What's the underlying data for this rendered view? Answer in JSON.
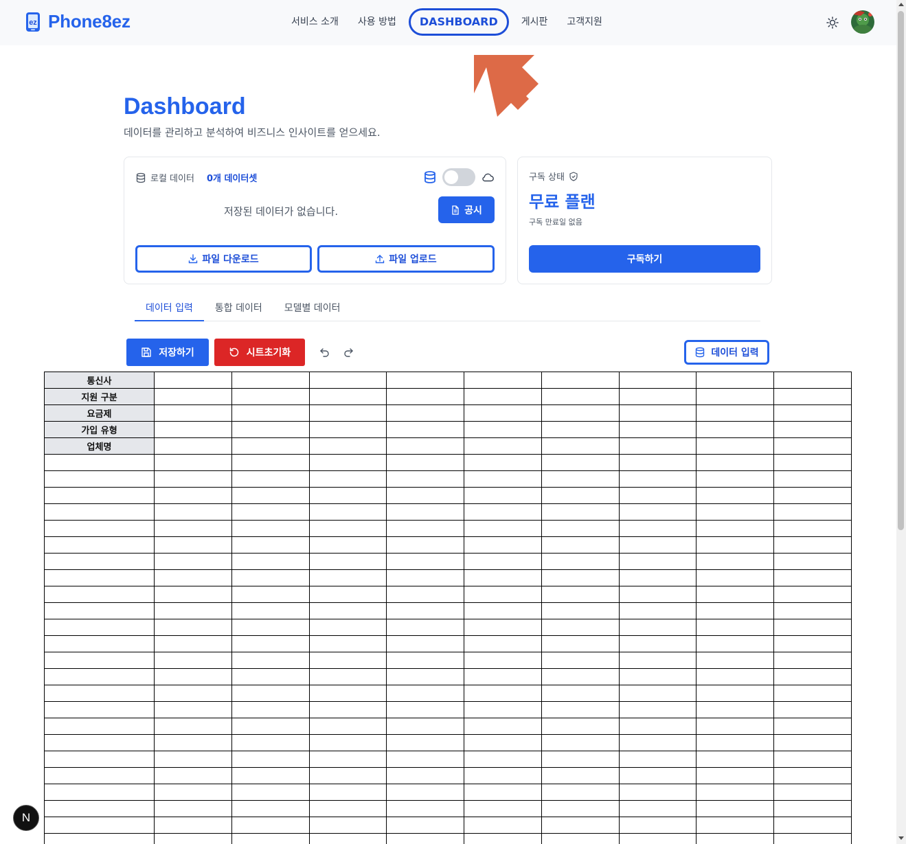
{
  "header": {
    "logo_text": "Phone8ez",
    "logo_badge": "ez",
    "nav": [
      {
        "label": "서비스 소개"
      },
      {
        "label": "사용 방법"
      },
      {
        "label": "DASHBOARD"
      },
      {
        "label": "게시판"
      },
      {
        "label": "고객지원"
      }
    ],
    "active_nav": "DASHBOARD",
    "theme_icon": "sun-icon",
    "avatar_icon": "user-avatar"
  },
  "page": {
    "title": "Dashboard",
    "subtitle": "데이터를 관리하고 분석하여 비즈니스 인사이트를 얻으세요."
  },
  "local_card": {
    "label": "로컬 데이터",
    "count": "0개 데이터셋",
    "empty_message": "저장된 데이터가 없습니다.",
    "notice_button": "공시",
    "download_button": "파일 다운로드",
    "upload_button": "파일 업로드",
    "sync_toggle_on": false
  },
  "subscription_card": {
    "label": "구독 상태",
    "plan": "무료 플랜",
    "expiry": "구독 만료일 없음",
    "button": "구독하기"
  },
  "tabs": [
    {
      "label": "데이터 입력"
    },
    {
      "label": "통합 데이터"
    },
    {
      "label": "모델별 데이터"
    }
  ],
  "active_tab": "데이터 입력",
  "toolbar": {
    "save": "저장하기",
    "reset": "시트초기화",
    "data_input": "데이터 입력"
  },
  "sheet": {
    "header_rows": [
      "통신사",
      "지원 구분",
      "요금제",
      "가입 유형",
      "업체명"
    ]
  },
  "colors": {
    "primary": "#2563eb",
    "danger": "#dc2626",
    "header_cell": "#e5e7eb",
    "arrow": "#dd6a47"
  },
  "badge": {
    "label": "N"
  }
}
